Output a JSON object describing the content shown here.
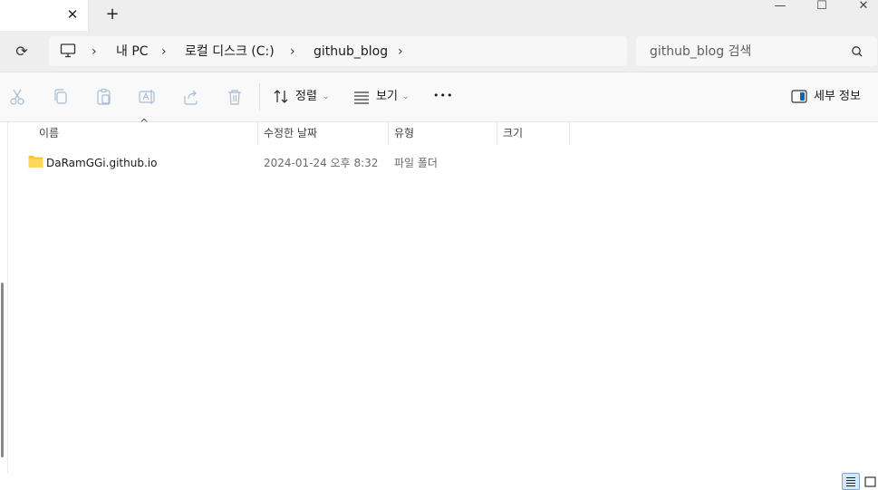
{
  "titlebar": {
    "tab_close_glyph": "✕",
    "tab_add_glyph": "+",
    "minimize_glyph": "—",
    "maximize_glyph": "☐",
    "close_glyph": "✕"
  },
  "address": {
    "refresh_glyph": "⟳",
    "breadcrumbs": [
      "내 PC",
      "로컬 디스크 (C:)",
      "github_blog"
    ],
    "chevron_glyph": "›"
  },
  "search": {
    "placeholder": "github_blog 검색"
  },
  "toolbar": {
    "sort_label": "정렬",
    "view_label": "보기",
    "more_glyph": "•••",
    "details_label": "세부 정보",
    "caret_glyph": "⌄"
  },
  "columns": {
    "name": "이름",
    "modified": "수정한 날짜",
    "type": "유형",
    "size": "크기",
    "sort_glyph": "^"
  },
  "files": [
    {
      "name": "DaRamGGi.github.io",
      "modified": "2024-01-24 오후 8:32",
      "type": "파일 폴더",
      "size": ""
    }
  ],
  "icons": {
    "folder": "folder-icon",
    "cut": "cut-icon",
    "copy": "copy-icon",
    "paste": "paste-icon",
    "rename": "rename-icon",
    "share": "share-icon",
    "delete": "delete-icon",
    "sort": "sort-icon",
    "view": "view-icon",
    "details": "details-pane-icon",
    "pc": "pc-icon"
  },
  "colors": {
    "folder": "#f5c342",
    "accent": "#0067c0",
    "titlebar_bg": "#eeeeee"
  }
}
